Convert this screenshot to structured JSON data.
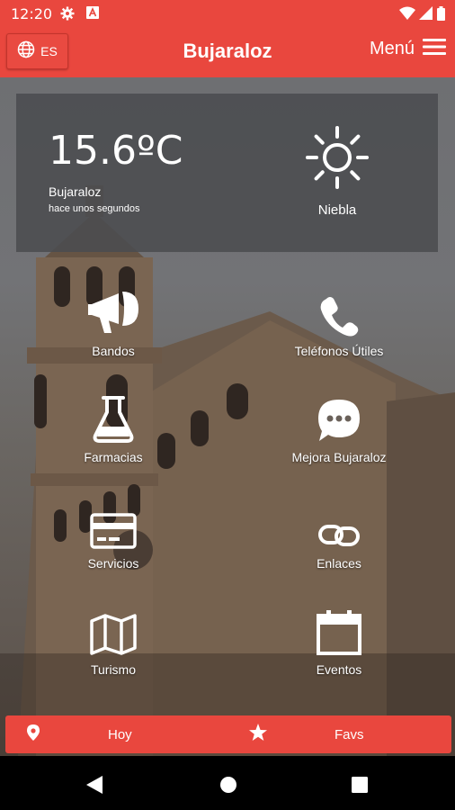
{
  "status_bar": {
    "time": "12:20"
  },
  "header": {
    "language": "ES",
    "title": "Bujaraloz",
    "menu_label": "Menú"
  },
  "weather": {
    "temperature": "15.6ºC",
    "location": "Bujaraloz",
    "updated": "hace unos segundos",
    "condition": "Niebla",
    "icon": "sun-icon"
  },
  "grid": [
    {
      "label": "Bandos",
      "icon": "megaphone-icon"
    },
    {
      "label": "Teléfonos Útiles",
      "icon": "phone-icon"
    },
    {
      "label": "Farmacias",
      "icon": "flask-icon"
    },
    {
      "label": "Mejora Bujaraloz",
      "icon": "chat-bubble-icon"
    },
    {
      "label": "Servicios",
      "icon": "credit-card-icon"
    },
    {
      "label": "Enlaces",
      "icon": "link-icon"
    },
    {
      "label": "Turismo",
      "icon": "map-icon"
    },
    {
      "label": "Eventos",
      "icon": "calendar-icon"
    }
  ],
  "bottom_bar": {
    "today_label": "Hoy",
    "favs_label": "Favs"
  },
  "colors": {
    "primary": "#e9473e",
    "weather_card": "#4b4c50"
  }
}
